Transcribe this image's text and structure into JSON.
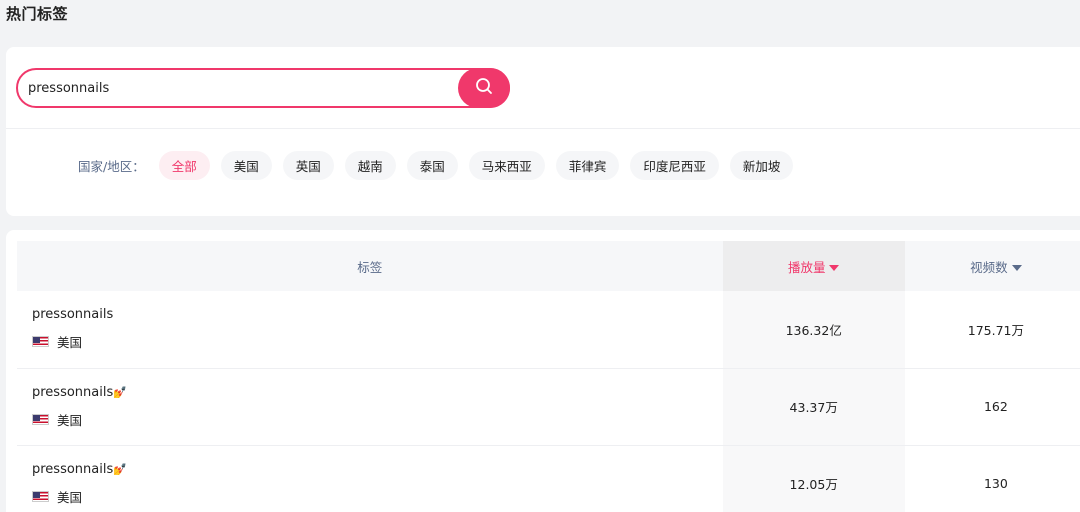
{
  "page_title": "热门标签",
  "search": {
    "value": "pressonnails",
    "placeholder": ""
  },
  "region_filter": {
    "label": "国家/地区：",
    "options": [
      "全部",
      "美国",
      "英国",
      "越南",
      "泰国",
      "马来西亚",
      "菲律宾",
      "印度尼西亚",
      "新加坡"
    ],
    "selected": "全部"
  },
  "table": {
    "columns": {
      "tag": "标签",
      "plays": "播放量",
      "videos": "视频数"
    },
    "sorted_by": "播放量",
    "rows": [
      {
        "tag": "pressonnails",
        "emoji": "",
        "country": "美国",
        "plays": "136.32亿",
        "videos": "175.71万"
      },
      {
        "tag": "pressonnails",
        "emoji": "💅",
        "country": "美国",
        "plays": "43.37万",
        "videos": "162"
      },
      {
        "tag": "pressonnails",
        "emoji": "💅",
        "country": "美国",
        "plays": "12.05万",
        "videos": "130"
      }
    ]
  },
  "colors": {
    "accent": "#f0386b",
    "muted_text": "#5a6b8a"
  },
  "icons": {
    "search_button": "search-icon",
    "flag": "us-flag-icon"
  }
}
